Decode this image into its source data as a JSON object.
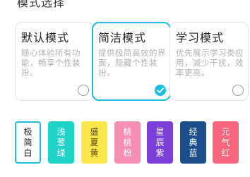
{
  "header": {
    "partial_title": "模式选择"
  },
  "modes": [
    {
      "title": "默认模式",
      "desc": "随心体验所有功能，畅享个性装扮。",
      "selected": false
    },
    {
      "title": "简洁模式",
      "desc": "提供极简高效的界面，隐藏个性装扮。",
      "selected": true
    },
    {
      "title": "学习模式",
      "desc": "优先展示学习类应用，减少干扰，效率更高。",
      "selected": false
    }
  ],
  "themes": [
    {
      "label": "极简白",
      "bg": "#ffffff",
      "fg": "#222222",
      "active": true
    },
    {
      "label": "浅葱绿",
      "bg": "#1fd3c6",
      "fg": "#ffffff",
      "active": false
    },
    {
      "label": "盛夏黄",
      "bg": "#fbe64b",
      "fg": "#5a4a10",
      "active": false
    },
    {
      "label": "桃桃粉",
      "bg": "#f78fb5",
      "fg": "#ffffff",
      "active": false
    },
    {
      "label": "星辰紫",
      "bg": "#7a3fd8",
      "fg": "#ffffff",
      "active": false
    },
    {
      "label": "经典蓝",
      "bg": "#1d4e8c",
      "fg": "#ffffff",
      "active": false
    },
    {
      "label": "元气红",
      "bg": "#f7667a",
      "fg": "#ffffff",
      "active": false
    }
  ],
  "colors": {
    "accent": "#1bbfe0"
  }
}
